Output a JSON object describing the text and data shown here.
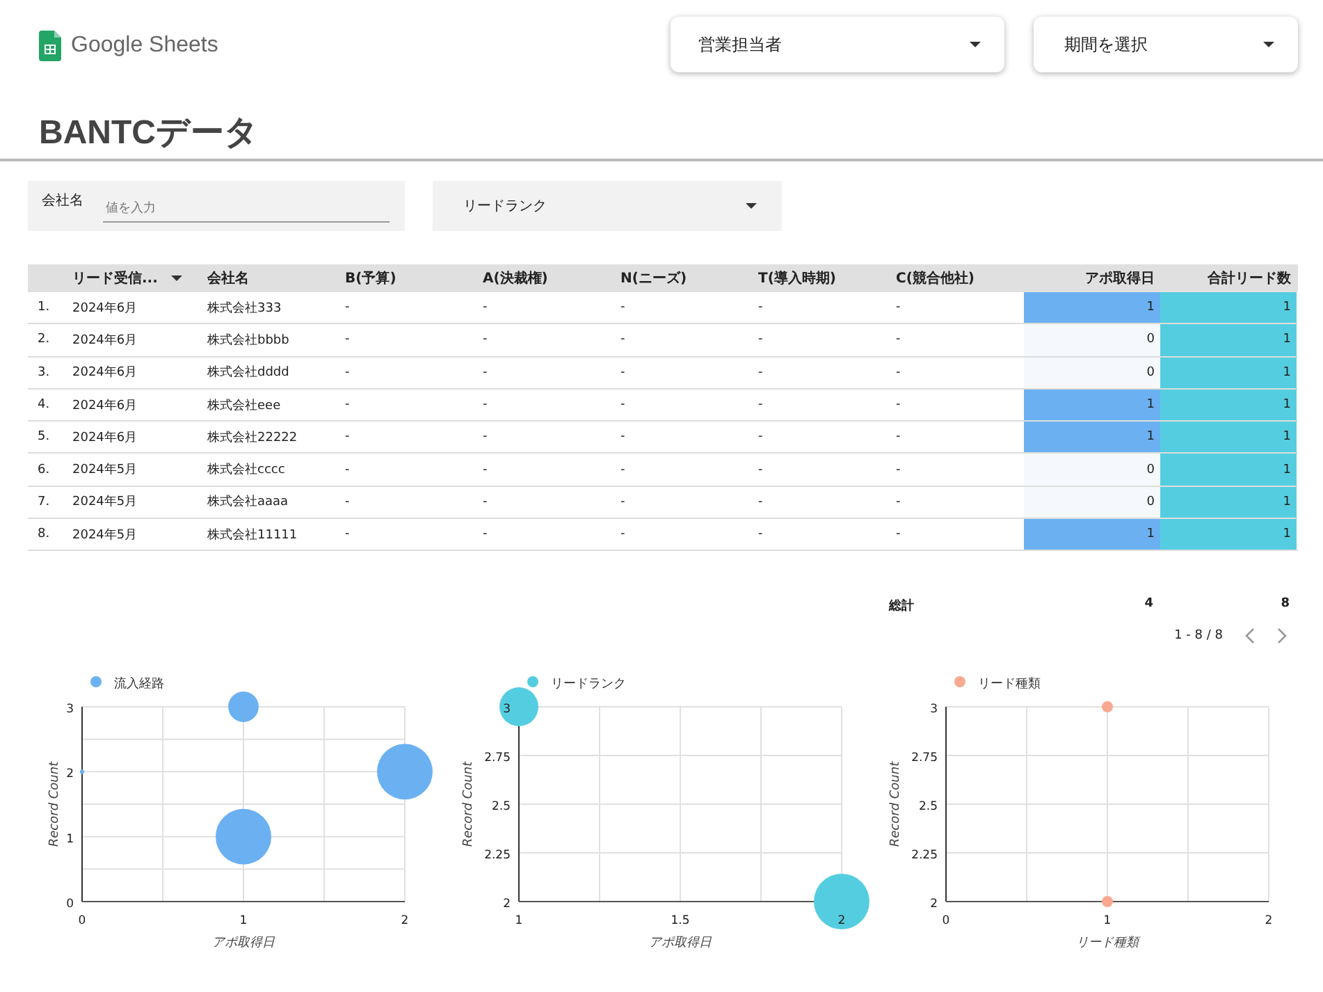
{
  "logo": {
    "text": "Google Sheets"
  },
  "controls": [
    {
      "label": "営業担当者"
    },
    {
      "label": "期間を選択"
    }
  ],
  "title": "BANTCデータ",
  "filters": {
    "company": {
      "label": "会社名",
      "placeholder": "値を入力"
    },
    "lead_rank": {
      "label": "リードランク"
    }
  },
  "table": {
    "columns": [
      {
        "label": "リード受信...",
        "sorted": true,
        "kind": "text"
      },
      {
        "label": "会社名",
        "sorted": false,
        "kind": "text"
      },
      {
        "label": "B(予算)",
        "sorted": false,
        "kind": "text"
      },
      {
        "label": "A(決裁権)",
        "sorted": false,
        "kind": "text"
      },
      {
        "label": "N(ニーズ)",
        "sorted": false,
        "kind": "text"
      },
      {
        "label": "T(導入時期)",
        "sorted": false,
        "kind": "text"
      },
      {
        "label": "C(競合他社)",
        "sorted": false,
        "kind": "text"
      },
      {
        "label": "アポ取得日",
        "sorted": false,
        "kind": "heat"
      },
      {
        "label": "合計リード数",
        "sorted": false,
        "kind": "bar"
      }
    ],
    "rows": [
      {
        "index": "1.",
        "cells": [
          "2024年6月",
          "株式会社333",
          "-",
          "-",
          "-",
          "-",
          "-",
          "1",
          "1"
        ]
      },
      {
        "index": "2.",
        "cells": [
          "2024年6月",
          "株式会社bbbb",
          "-",
          "-",
          "-",
          "-",
          "-",
          "0",
          "1"
        ]
      },
      {
        "index": "3.",
        "cells": [
          "2024年6月",
          "株式会社dddd",
          "-",
          "-",
          "-",
          "-",
          "-",
          "0",
          "1"
        ]
      },
      {
        "index": "4.",
        "cells": [
          "2024年6月",
          "株式会社eee",
          "-",
          "-",
          "-",
          "-",
          "-",
          "1",
          "1"
        ]
      },
      {
        "index": "5.",
        "cells": [
          "2024年6月",
          "株式会社22222",
          "-",
          "-",
          "-",
          "-",
          "-",
          "1",
          "1"
        ]
      },
      {
        "index": "6.",
        "cells": [
          "2024年5月",
          "株式会社cccc",
          "-",
          "-",
          "-",
          "-",
          "-",
          "0",
          "1"
        ]
      },
      {
        "index": "7.",
        "cells": [
          "2024年5月",
          "株式会社aaaa",
          "-",
          "-",
          "-",
          "-",
          "-",
          "0",
          "1"
        ]
      },
      {
        "index": "8.",
        "cells": [
          "2024年5月",
          "株式会社11111",
          "-",
          "-",
          "-",
          "-",
          "-",
          "1",
          "1"
        ]
      }
    ],
    "totals": {
      "label": "総計",
      "values": [
        "4",
        "8"
      ]
    },
    "pagination": {
      "range": "1 - 8 / 8"
    }
  },
  "charts": [
    {
      "chart_data": {
        "type": "scatter",
        "xlabel": "アポ取得日",
        "ylabel": "Record Count",
        "x": [
          0,
          1,
          1,
          2
        ],
        "series": [
          {
            "name": "流入経路",
            "color": "#6bb1f2",
            "values": [
              2,
              3,
              1,
              2
            ],
            "sizes": [
              0.006,
              0.3,
              1,
              1
            ]
          }
        ],
        "grid": true,
        "xlim": [
          0,
          2
        ],
        "ylim": [
          0,
          3
        ],
        "xticks": [
          0,
          1,
          2
        ],
        "yticks": [
          0,
          1,
          2,
          3
        ],
        "data_labels": false
      }
    },
    {
      "chart_data": {
        "type": "scatter",
        "xlabel": "アポ取得日",
        "ylabel": "Record Count",
        "x": [
          1,
          2
        ],
        "series": [
          {
            "name": "リードランク",
            "color": "#55cde0",
            "values": [
              3,
              2
            ],
            "sizes": [
              0.49,
              1
            ]
          }
        ],
        "grid": true,
        "xlim": [
          1,
          2
        ],
        "ylim": [
          2,
          3
        ],
        "xticks": [
          1,
          1.5,
          2
        ],
        "yticks": [
          2,
          2.25,
          2.5,
          2.75,
          3
        ],
        "data_labels": false
      }
    },
    {
      "chart_data": {
        "type": "scatter",
        "xlabel": "リード種類",
        "ylabel": "Record Count",
        "x": [
          1,
          1
        ],
        "series": [
          {
            "name": "リード種類",
            "color": "#f9a98f",
            "values": [
              3,
              2
            ]
          }
        ],
        "grid": true,
        "xlim": [
          0,
          2
        ],
        "ylim": [
          2,
          3
        ],
        "xticks": [
          0,
          1,
          2
        ],
        "yticks": [
          2,
          2.25,
          2.5,
          2.75,
          3
        ],
        "data_labels": false
      }
    }
  ]
}
